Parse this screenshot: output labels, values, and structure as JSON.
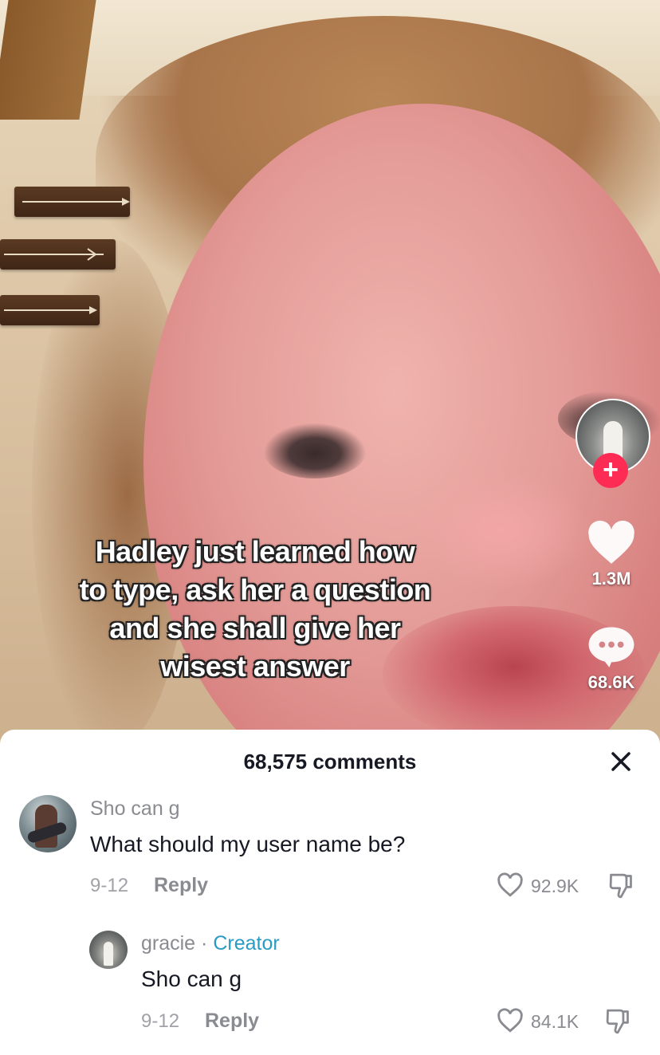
{
  "video": {
    "caption_lines": [
      "Hadley just learned how",
      "to type, ask her a question",
      "and she shall give her",
      "wisest answer"
    ]
  },
  "rail": {
    "follow_label": "+",
    "likes": "1.3M",
    "comments": "68.6K"
  },
  "comments_sheet": {
    "title": "68,575 comments",
    "close_label": "×",
    "comments": [
      {
        "username": "Sho can g",
        "text": "What should my user name be?",
        "date": "9-12",
        "reply_label": "Reply",
        "likes": "92.9K"
      },
      {
        "username": "gracie",
        "separator": "·",
        "badge": "Creator",
        "text": "Sho can g",
        "date": "9-12",
        "reply_label": "Reply",
        "likes": "84.1K"
      }
    ]
  },
  "colors": {
    "follow_red": "#fe2c55",
    "creator_blue": "#2a9bc4",
    "text_dark": "#161823",
    "text_muted": "#8a8b91"
  }
}
